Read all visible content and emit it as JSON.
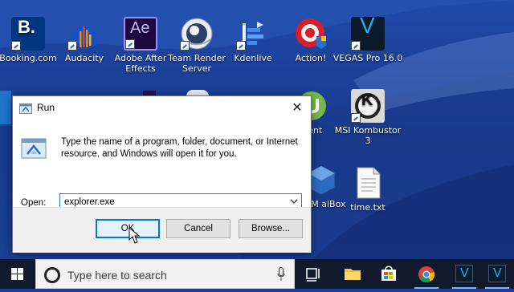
{
  "desktop": {
    "icons": [
      {
        "label": "Booking.com"
      },
      {
        "label": "Audacity"
      },
      {
        "label": "Adobe After Effects"
      },
      {
        "label": "Team Render Server"
      },
      {
        "label": "Kdenlive"
      },
      {
        "label": "Action!"
      },
      {
        "label": "VEGAS Pro 16.0"
      },
      {
        "label": "MSI Kombustor 3"
      },
      {
        "label": "time.txt"
      },
      {
        "label": "rrent"
      },
      {
        "label": "e VM alBox"
      }
    ],
    "icon_glyphs": {
      "booking": "B.",
      "after_effects": "Ae",
      "vegas": "V",
      "kombustor": "K"
    }
  },
  "run_dialog": {
    "title": "Run",
    "close_glyph": "✕",
    "description": "Type the name of a program, folder, document, or Internet resource, and Windows will open it for you.",
    "open_label": "Open:",
    "open_value": "explorer.exe",
    "buttons": {
      "ok": "OK",
      "cancel": "Cancel",
      "browse": "Browse..."
    }
  },
  "taskbar": {
    "search_placeholder": "Type here to search",
    "apps": [
      "task-view",
      "file-explorer",
      "store",
      "chrome",
      "vegas-pro",
      "vegas-pro-2"
    ],
    "vegas_glyph": "V"
  },
  "colors": {
    "accent": "#0078d7",
    "taskbar": "#101a2c",
    "wallpaper": "#1b3f93"
  }
}
